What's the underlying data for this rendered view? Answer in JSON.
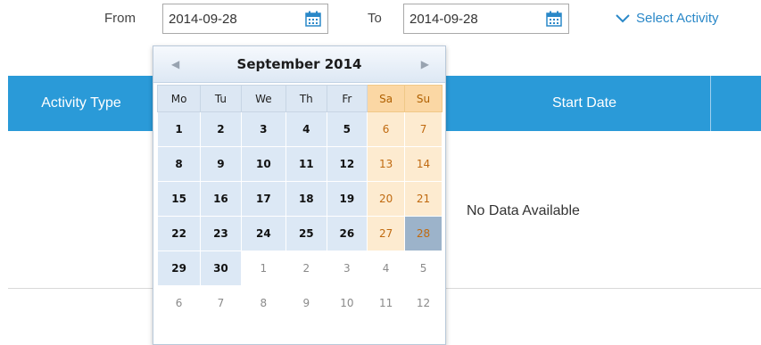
{
  "filters": {
    "from_label": "From",
    "from_value": "2014-09-28",
    "to_label": "To",
    "to_value": "2014-09-28",
    "select_activity_label": "Select Activity",
    "calendar_icon": "calendar-icon",
    "chevron_icon": "chevron-down-icon"
  },
  "table": {
    "columns": [
      "Activity Type",
      "",
      "Start Date"
    ],
    "empty_text": "No Data Available"
  },
  "calendar": {
    "title": "September 2014",
    "prev": "◀",
    "next": "▶",
    "weekdays": [
      "Mo",
      "Tu",
      "We",
      "Th",
      "Fr",
      "Sa",
      "Su"
    ],
    "weeks": [
      [
        "1",
        "2",
        "3",
        "4",
        "5",
        "6",
        "7"
      ],
      [
        "8",
        "9",
        "10",
        "11",
        "12",
        "13",
        "14"
      ],
      [
        "15",
        "16",
        "17",
        "18",
        "19",
        "20",
        "21"
      ],
      [
        "22",
        "23",
        "24",
        "25",
        "26",
        "27",
        "28"
      ],
      [
        "29",
        "30",
        "1",
        "2",
        "3",
        "4",
        "5"
      ],
      [
        "6",
        "7",
        "8",
        "9",
        "10",
        "11",
        "12"
      ]
    ],
    "selected_day": "28"
  },
  "colors": {
    "accent": "#2a9ad8",
    "link": "#2a88c8",
    "weekend": "#fdebd0",
    "weekend_header": "#fbd7a4",
    "selected": "#9cb3ca"
  }
}
